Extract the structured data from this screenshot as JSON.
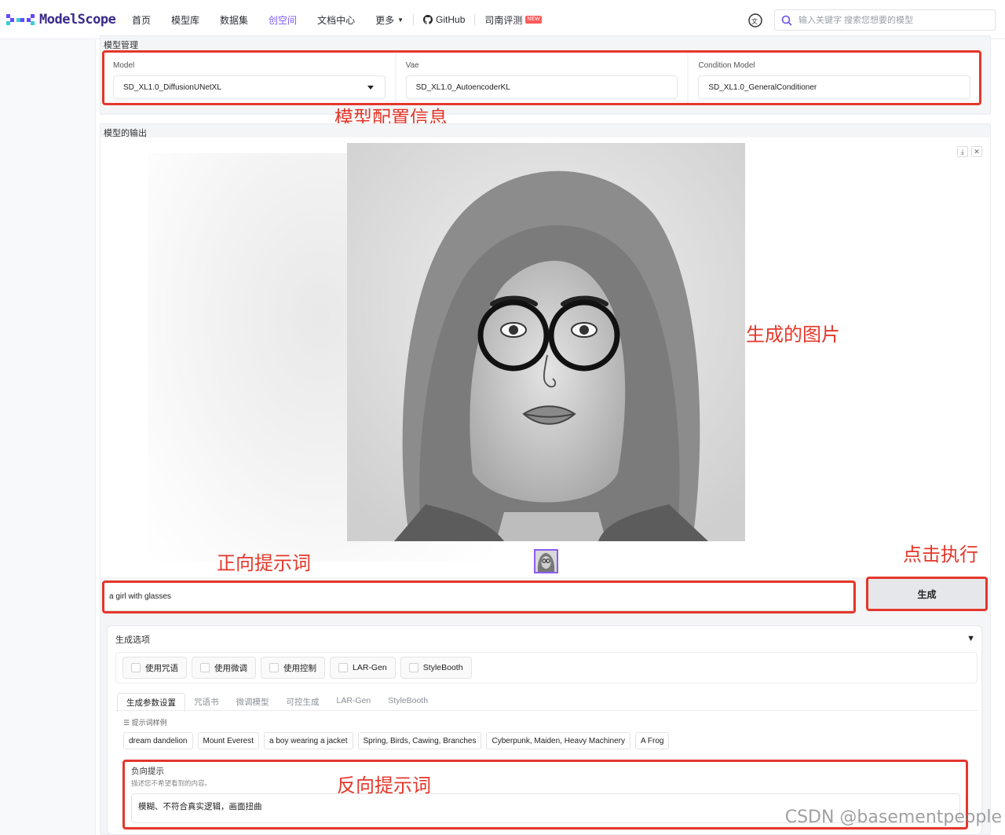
{
  "nav": {
    "logo_text": "ModelScope",
    "items": [
      {
        "label": "首页"
      },
      {
        "label": "模型库"
      },
      {
        "label": "数据集"
      },
      {
        "label": "创空间",
        "active": true
      },
      {
        "label": "文档中心"
      },
      {
        "label": "更多"
      }
    ],
    "github": "GitHub",
    "eval_label": "司南评测",
    "eval_badge": "NEW",
    "search_placeholder": "输入关键字 搜索您想要的模型"
  },
  "model_section": {
    "title": "模型管理",
    "fields": [
      {
        "label": "Model",
        "value": "SD_XL1.0_DiffusionUNetXL"
      },
      {
        "label": "Vae",
        "value": "SD_XL1.0_AutoencoderKL"
      },
      {
        "label": "Condition Model",
        "value": "SD_XL1.0_GeneralConditioner"
      }
    ]
  },
  "output_section": {
    "title": "模型的输出"
  },
  "prompt": {
    "value": "a girl with glasses",
    "generate_label": "生成"
  },
  "options": {
    "title": "生成选项",
    "checkboxes": [
      "使用咒语",
      "使用微调",
      "使用控制",
      "LAR-Gen",
      "StyleBooth"
    ],
    "tabs": [
      "生成参数设置",
      "咒语书",
      "微调模型",
      "可控生成",
      "LAR-Gen",
      "StyleBooth"
    ],
    "examples_label": "提示词样例",
    "examples": [
      "dream dandelion",
      "Mount Everest",
      "a boy wearing a jacket",
      "Spring, Birds, Cawing, Branches",
      "Cyberpunk, Maiden, Heavy Machinery",
      "A Frog"
    ],
    "negative": {
      "label": "负向提示",
      "desc": "描述您不希望看到的内容。",
      "value": "模糊、不符合真实逻辑，画面扭曲"
    }
  },
  "annotations": {
    "model_config": "模型配置信息",
    "generated_image": "生成的图片",
    "positive_prompt": "正向提示词",
    "click_run": "点击执行",
    "negative_prompt": "反向提示词"
  },
  "watermark": "CSDN @basementpeople",
  "colors": {
    "accent": "#7a5af5",
    "annotation_red": "#e4372a"
  }
}
